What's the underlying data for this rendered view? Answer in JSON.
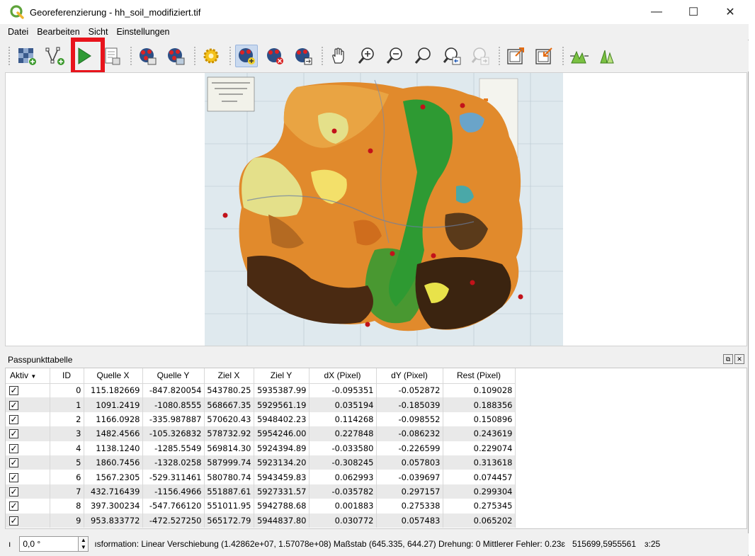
{
  "window": {
    "title": "Georeferenzierung - hh_soil_modifiziert.tif",
    "minimize": "—",
    "maximize": "☐",
    "close": "✕"
  },
  "menu": [
    "Datei",
    "Bearbeiten",
    "Sicht",
    "Einstellungen"
  ],
  "toolbar": {
    "icons": [
      "open-raster-icon",
      "start-georeferencing-icon",
      "generate-gdal-script-icon",
      "load-gcp-icon",
      "save-gcp-icon",
      "transformation-settings-icon",
      "add-point-icon",
      "delete-point-icon",
      "move-gcp-icon",
      "pan-icon",
      "zoom-in-icon",
      "zoom-out-icon",
      "zoom-to-layer-icon",
      "zoom-last-icon",
      "zoom-next-icon",
      "link-georef-to-qgis-icon",
      "link-qgis-to-georef-icon",
      "full-histogram-stretch-icon",
      "local-histogram-stretch-icon"
    ],
    "highlight_color": "#e8141c"
  },
  "panel": {
    "title": "Passpunkttabelle"
  },
  "table": {
    "headers": [
      "Aktiv",
      "ID",
      "Quelle X",
      "Quelle Y",
      "Ziel X",
      "Ziel Y",
      "dX (Pixel)",
      "dY (Pixel)",
      "Rest (Pixel)"
    ],
    "rows": [
      [
        "✓",
        "0",
        "115.182669",
        "-847.820054",
        "543780.25",
        "5935387.99",
        "-0.095351",
        "-0.052872",
        "0.109028"
      ],
      [
        "✓",
        "1",
        "1091.2419",
        "-1080.8555",
        "568667.35",
        "5929561.19",
        "0.035194",
        "-0.185039",
        "0.188356"
      ],
      [
        "✓",
        "2",
        "1166.0928",
        "-335.987887",
        "570620.43",
        "5948402.23",
        "0.114268",
        "-0.098552",
        "0.150896"
      ],
      [
        "✓",
        "3",
        "1482.4566",
        "-105.326832",
        "578732.92",
        "5954246.00",
        "0.227848",
        "-0.086232",
        "0.243619"
      ],
      [
        "✓",
        "4",
        "1138.1240",
        "-1285.5549",
        "569814.30",
        "5924394.89",
        "-0.033580",
        "-0.226599",
        "0.229074"
      ],
      [
        "✓",
        "5",
        "1860.7456",
        "-1328.0258",
        "587999.74",
        "5923134.20",
        "-0.308245",
        "0.057803",
        "0.313618"
      ],
      [
        "✓",
        "6",
        "1567.2305",
        "-529.311461",
        "580780.74",
        "5943459.83",
        "0.062993",
        "-0.039697",
        "0.074457"
      ],
      [
        "✓",
        "7",
        "432.716439",
        "-1156.4966",
        "551887.61",
        "5927331.57",
        "-0.035782",
        "0.297157",
        "0.299304"
      ],
      [
        "✓",
        "8",
        "397.300234",
        "-547.766120",
        "551011.95",
        "5942788.68",
        "0.001883",
        "0.275338",
        "0.275345"
      ],
      [
        "✓",
        "9",
        "953.833772",
        "-472.527250",
        "565172.79",
        "5944837.80",
        "0.030772",
        "0.057483",
        "0.065202"
      ]
    ]
  },
  "status": {
    "rotation_prefix": "ı",
    "rotation_value": "0,0 °",
    "transformation": "ısformation: Linear Verschiebung (1.42862e+07, 1.57078e+08) Maßstab (645.335, 644.27) Drehung: 0 Mittlerer Fehler: 0.23ɛ",
    "coordinates": "515699,5955561",
    "epsg": "ɜ:25"
  }
}
